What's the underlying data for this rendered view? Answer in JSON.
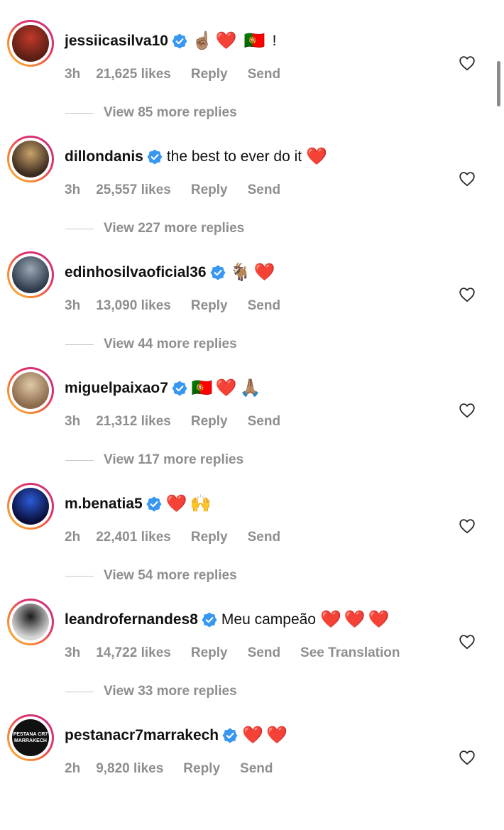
{
  "comments": [
    {
      "username": "jessiicasilva10",
      "text": "",
      "emojis": [
        "☝🏽",
        "❤️",
        "🇵🇹"
      ],
      "trailing": "!",
      "time": "3h",
      "likes": "21,625 likes",
      "reply": "Reply",
      "send": "Send",
      "see_translation": "",
      "view_replies": "View 85 more replies",
      "avatar_colors": [
        "#5a1e14",
        "#c0392b"
      ]
    },
    {
      "username": "dillondanis",
      "text": "the best to ever do it",
      "emojis": [
        "❤️"
      ],
      "trailing": "",
      "time": "3h",
      "likes": "25,557 likes",
      "reply": "Reply",
      "send": "Send",
      "see_translation": "",
      "view_replies": "View 227 more replies",
      "avatar_colors": [
        "#3b2a1e",
        "#c8a36a"
      ]
    },
    {
      "username": "edinhosilvaoficial36",
      "text": "",
      "emojis": [
        "🐐",
        "❤️"
      ],
      "trailing": "",
      "time": "3h",
      "likes": "13,090 likes",
      "reply": "Reply",
      "send": "Send",
      "see_translation": "",
      "view_replies": "View 44 more replies",
      "avatar_colors": [
        "#2d3a4a",
        "#9aa7b4"
      ]
    },
    {
      "username": "miguelpaixao7",
      "text": "",
      "emojis": [
        "🇵🇹",
        "❤️",
        "🙏🏽"
      ],
      "trailing": "",
      "time": "3h",
      "likes": "21,312 likes",
      "reply": "Reply",
      "send": "Send",
      "see_translation": "",
      "view_replies": "View 117 more replies",
      "avatar_colors": [
        "#8a6a4a",
        "#e0c9a8"
      ]
    },
    {
      "username": "m.benatia5",
      "text": "",
      "emojis": [
        "❤️",
        "🙌"
      ],
      "trailing": "",
      "time": "2h",
      "likes": "22,401 likes",
      "reply": "Reply",
      "send": "Send",
      "see_translation": "",
      "view_replies": "View 54 more replies",
      "avatar_colors": [
        "#0a0f3a",
        "#2b5bd6"
      ]
    },
    {
      "username": "leandrofernandes8",
      "text": "Meu campeão",
      "emojis": [
        "❤️",
        "❤️",
        "❤️"
      ],
      "trailing": "",
      "time": "3h",
      "likes": "14,722 likes",
      "reply": "Reply",
      "send": "Send",
      "see_translation": "See Translation",
      "view_replies": "View 33 more replies",
      "avatar_colors": [
        "#d8d8d8",
        "#1a1a1a"
      ]
    },
    {
      "username": "pestanacr7marrakech",
      "text": "",
      "emojis": [
        "❤️",
        "❤️"
      ],
      "trailing": "",
      "time": "2h",
      "likes": "9,820 likes",
      "reply": "Reply",
      "send": "Send",
      "see_translation": "",
      "view_replies": "",
      "avatar_colors": [
        "#111111",
        "#111111"
      ],
      "avatar_text": "PESTANA CR7\nMARRAKECH"
    }
  ],
  "colors": {
    "verified": "#3897f0",
    "meta_text": "#8e8e8e",
    "heart_icon": "#262626"
  },
  "icons": {
    "verified": "verified-badge-icon",
    "like": "heart-outline-icon"
  }
}
